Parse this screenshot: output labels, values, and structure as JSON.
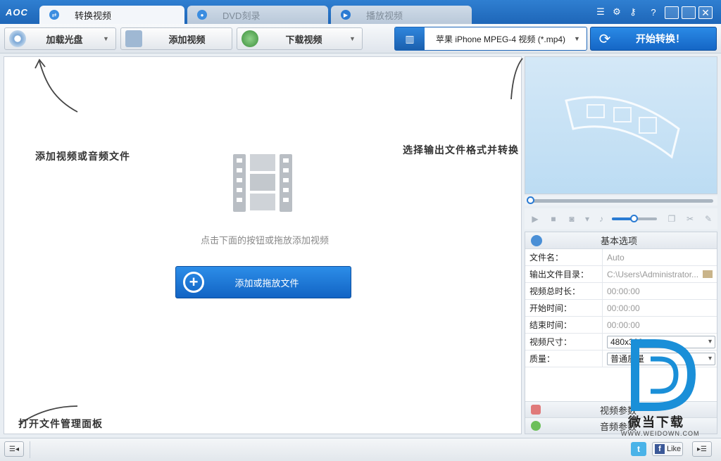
{
  "app": {
    "logo": "AOC"
  },
  "tabs": [
    {
      "label": "转换视频",
      "active": true
    },
    {
      "label": "DVD刻录",
      "active": false
    },
    {
      "label": "播放视频",
      "active": false
    }
  ],
  "toolbar": {
    "load_disc": "加载光盘",
    "add_video": "添加视频",
    "download_video": "下载视频",
    "format": "苹果 iPhone MPEG-4 视频 (*.mp4)",
    "start": "开始转换！"
  },
  "main": {
    "hint": "点击下面的按钮或拖放添加视频",
    "add_button": "添加或拖放文件",
    "annotations": {
      "add_files": "添加视频或音频文件",
      "choose_format": "选择输出文件格式并转换",
      "open_panel": "打开文件管理面板"
    }
  },
  "player": {
    "volume_percent": 50
  },
  "props": {
    "header": "基本选项",
    "rows": [
      {
        "key": "文件名：",
        "value": "Auto"
      },
      {
        "key": "输出文件目录：",
        "value": "C:\\Users\\Administrator..."
      },
      {
        "key": "视频总时长：",
        "value": "00:00:00"
      },
      {
        "key": "开始时间：",
        "value": "00:00:00"
      },
      {
        "key": "结束时间：",
        "value": "00:00:00"
      },
      {
        "key": "视频尺寸：",
        "value": "480x320"
      },
      {
        "key": "质量：",
        "value": "普通质量"
      }
    ],
    "video_params": "视频参数",
    "audio_params": "音频参数"
  },
  "social": {
    "twitter": "t",
    "facebook_like": "Like"
  },
  "watermark": {
    "brand": "微当下载",
    "url": "WWW.WEIDOWN.COM"
  },
  "colors": {
    "accent": "#1e66b8",
    "button_blue": "#1566c6"
  }
}
